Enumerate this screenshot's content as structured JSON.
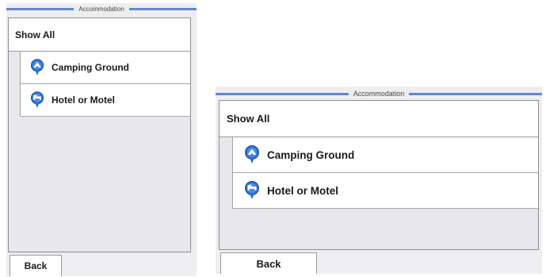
{
  "screens": [
    {
      "header": {
        "title": "Accommodation"
      },
      "list": [
        {
          "label": "Show All"
        },
        {
          "label": "Camping Ground",
          "icon": "camping-tent-pin-icon"
        },
        {
          "label": "Hotel or Motel",
          "icon": "hotel-bed-pin-icon"
        }
      ],
      "footer": {
        "back_label": "Back"
      }
    },
    {
      "header": {
        "title": "Accommodation"
      },
      "list": [
        {
          "label": "Show All"
        },
        {
          "label": "Camping Ground",
          "icon": "camping-tent-pin-icon"
        },
        {
          "label": "Hotel or Motel",
          "icon": "hotel-bed-pin-icon"
        }
      ],
      "footer": {
        "back_label": "Back"
      }
    }
  ],
  "colors": {
    "header_line": "#5f86d4",
    "icon_blue": "#2f6fd1",
    "panel_bg": "#e8e8ec"
  }
}
